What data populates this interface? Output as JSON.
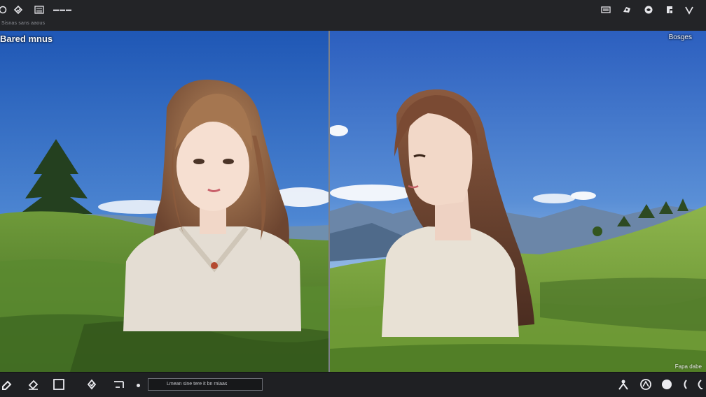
{
  "topbar": {
    "icons_left": [
      "refresh-icon",
      "brush-icon",
      "menu-icon"
    ],
    "short_label": "▬▬▬",
    "sublabel": "Sisnas sans aaous",
    "icons_right": [
      "image-icon",
      "palette-icon",
      "globe-icon",
      "contrast-icon",
      "shield-icon"
    ]
  },
  "viewer": {
    "left_label": "Bared mnus",
    "right_label": "Bosges",
    "corner_note": "Fapa dabe"
  },
  "bottombar": {
    "tools_left": [
      "pen-icon",
      "eraser-icon",
      "square-icon",
      "lasso-icon",
      "bracket-icon"
    ],
    "status_text": "Lmean sine tere it bn rniaas",
    "tools_right": [
      "figure-icon",
      "globe-icon",
      "circle-icon",
      "moon-icon",
      "arc-icon"
    ]
  },
  "colors": {
    "sky_top": "#2d66c4",
    "sky_bottom": "#a7c8e8",
    "grass": "#7aa23e",
    "toolbar": "#232427"
  }
}
